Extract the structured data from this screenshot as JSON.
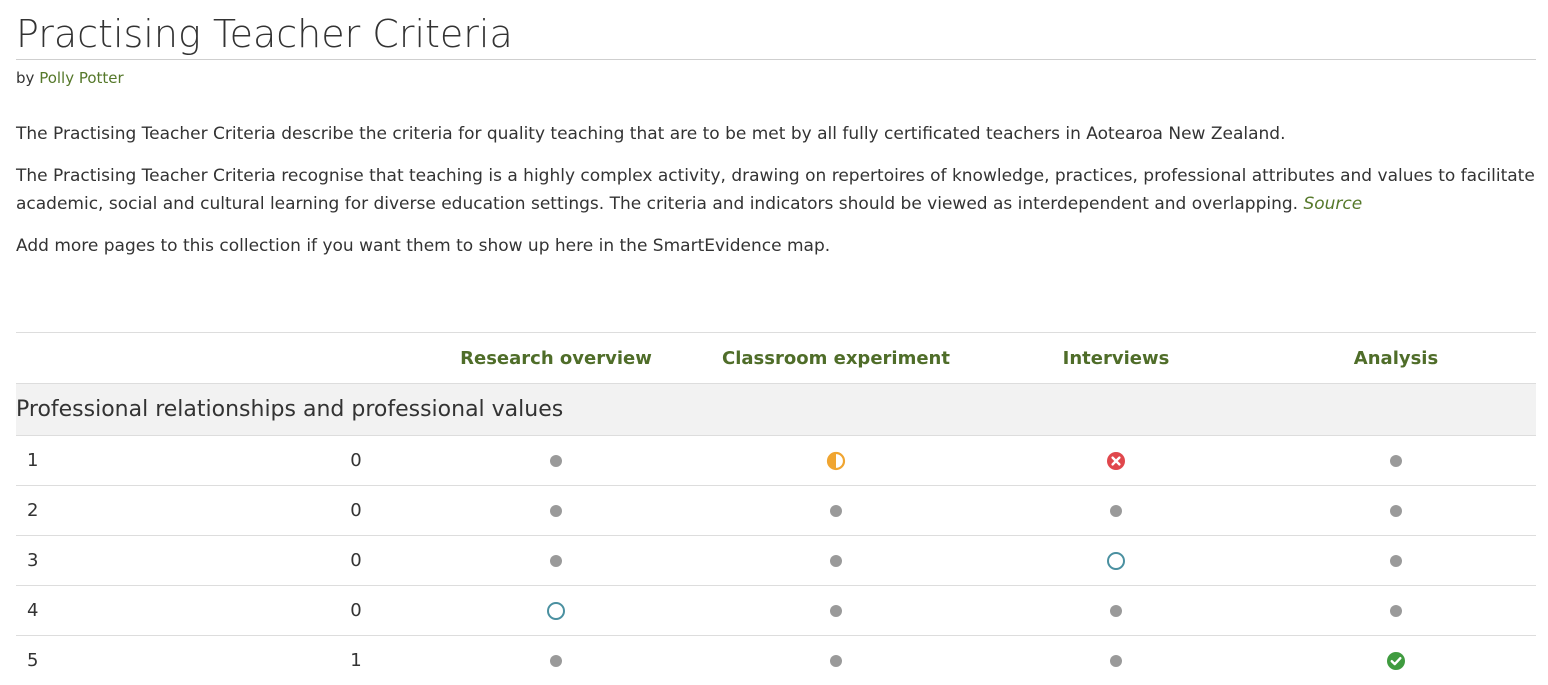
{
  "title": "Practising Teacher Criteria",
  "byline": {
    "prefix": "by",
    "author": "Polly Potter"
  },
  "description": {
    "p1": "The Practising Teacher Criteria describe the criteria for quality teaching that are to be met by all fully certificated teachers in Aotearoa New Zealand.",
    "p2": "The Practising Teacher Criteria recognise that teaching is a highly complex activity, drawing on repertoires of knowledge, practices, professional attributes and values to facilitate academic, social and cultural learning for diverse education settings. The criteria and indicators should be viewed as interdependent and overlapping.",
    "source_link": "Source",
    "p3": "Add more pages to this collection if you want them to show up here in the SmartEvidence map."
  },
  "columns": [
    "Research overview",
    "Classroom experiment",
    "Interviews",
    "Analysis"
  ],
  "section": {
    "title": "Professional relationships and professional values"
  },
  "rows": [
    {
      "label": "1",
      "count": "0"
    },
    {
      "label": "2",
      "count": "0"
    },
    {
      "label": "3",
      "count": "0"
    },
    {
      "label": "4",
      "count": "0"
    },
    {
      "label": "5",
      "count": "1"
    }
  ],
  "status_matrix": [
    [
      "none",
      "partial",
      "not-met",
      "none"
    ],
    [
      "none",
      "none",
      "none",
      "none"
    ],
    [
      "none",
      "none",
      "ready",
      "none"
    ],
    [
      "ready",
      "none",
      "none",
      "none"
    ],
    [
      "none",
      "none",
      "none",
      "completed"
    ]
  ],
  "colors": {
    "link": "#55782a",
    "column_header": "#4f6d29",
    "status_none": "#9a9a9a",
    "status_partial": "#f0a531",
    "status_not_met": "#e0474c",
    "status_ready": "#4a90a0",
    "status_completed": "#3f9b3f"
  }
}
